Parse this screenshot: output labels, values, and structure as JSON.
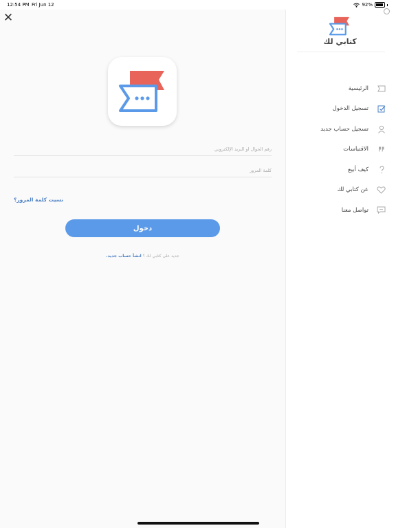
{
  "status_bar": {
    "time": "12:54 PM",
    "date": "Fri Jun 12",
    "battery": "92%",
    "wifi_icon": "wifi-icon",
    "battery_icon": "battery-icon"
  },
  "login": {
    "close_icon": "close-icon",
    "logo_icon": "app-logo-icon",
    "phone_email_placeholder": "رقم الجوال او البريد الإلكتروني",
    "password_placeholder": "كلمة المرور",
    "forgot_password": "نسيت كلمة المرور؟",
    "login_button": "دخول",
    "new_user_prompt": "جديد على كتابي لك ؟",
    "create_account": "انشأ حساب جديد."
  },
  "sidebar": {
    "brand": "كتابي لك",
    "items": [
      {
        "label": "الرئيسية",
        "icon": "home-icon"
      },
      {
        "label": "تسجيل الدخول",
        "icon": "login-check-icon"
      },
      {
        "label": "تسجيل حساب جديد",
        "icon": "user-icon"
      },
      {
        "label": "الاقتباسات",
        "icon": "quote-icon"
      },
      {
        "label": "كيف أبيع",
        "icon": "question-icon"
      },
      {
        "label": "عن كتابي لك",
        "icon": "heart-icon"
      },
      {
        "label": "تواصل معنا",
        "icon": "chat-icon"
      }
    ]
  },
  "colors": {
    "accent": "#5b9ae8",
    "link": "#4a7fc4",
    "logo_red": "#e8645a",
    "logo_blue": "#5b9ae8"
  }
}
